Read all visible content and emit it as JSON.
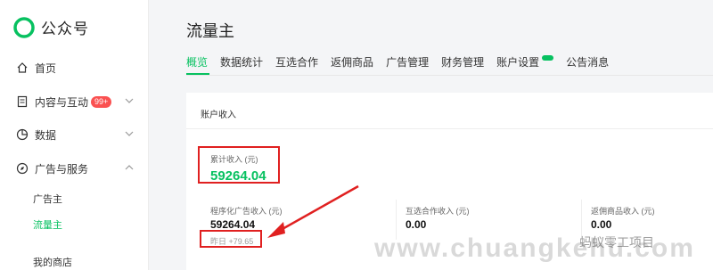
{
  "brand": {
    "name": "公众号",
    "accent": "#07c160"
  },
  "sidebar": {
    "items": [
      {
        "label": "首页",
        "icon": "home-icon"
      },
      {
        "label": "内容与互动",
        "icon": "document-icon",
        "badge": "99+"
      },
      {
        "label": "数据",
        "icon": "pie-chart-icon"
      },
      {
        "label": "广告与服务",
        "icon": "compass-icon"
      }
    ],
    "sub_items": [
      {
        "label": "广告主"
      },
      {
        "label": "流量主"
      },
      {
        "label": "我的商店"
      }
    ]
  },
  "page": {
    "title": "流量主"
  },
  "tabs": [
    {
      "label": "概览"
    },
    {
      "label": "数据统计"
    },
    {
      "label": "互选合作"
    },
    {
      "label": "返佣商品"
    },
    {
      "label": "广告管理"
    },
    {
      "label": "财务管理"
    },
    {
      "label": "账户设置"
    },
    {
      "label": "公告消息"
    }
  ],
  "account": {
    "title": "账户收入",
    "total_label": "累计收入 (元)",
    "total_value": "59264.04",
    "metrics": [
      {
        "label": "程序化广告收入 (元)",
        "value": "59264.04"
      },
      {
        "label": "互选合作收入 (元)",
        "value": "0.00"
      },
      {
        "label": "返佣商品收入 (元)",
        "value": "0.00"
      }
    ],
    "yesterday": "昨日 +79.65"
  },
  "watermark": {
    "text": "www.chuangkehu.com",
    "cn": "蚂蚁零工项目"
  },
  "colors": {
    "highlight": "#e02020",
    "accent": "#07c160"
  }
}
